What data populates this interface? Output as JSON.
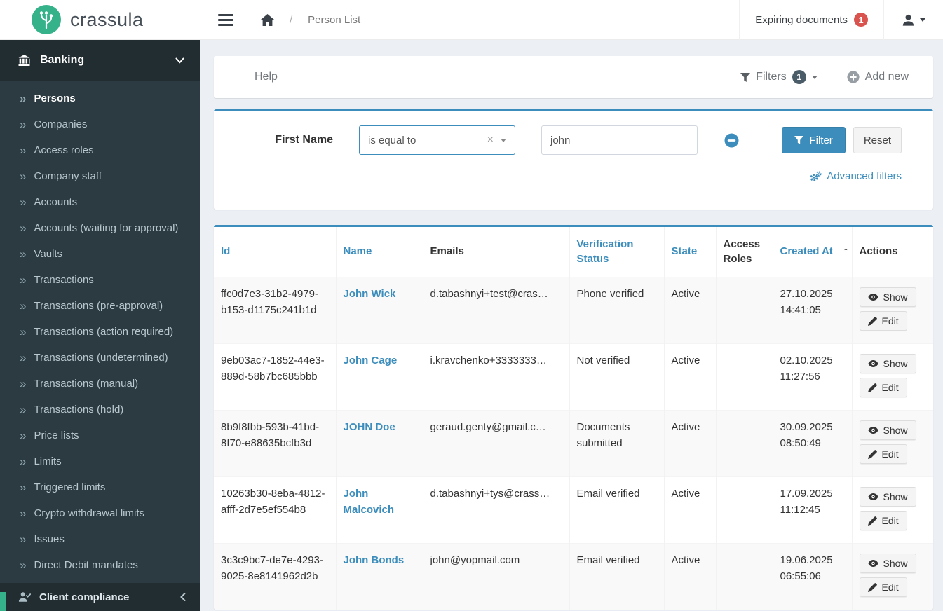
{
  "brand": {
    "name": "crassula"
  },
  "topbar": {
    "breadcrumb": "Person List",
    "expiring_documents_label": "Expiring documents",
    "expiring_documents_count": "1"
  },
  "sidebar": {
    "section_label": "Banking",
    "items": [
      {
        "label": "Persons",
        "active": true
      },
      {
        "label": "Companies"
      },
      {
        "label": "Access roles"
      },
      {
        "label": "Company staff"
      },
      {
        "label": "Accounts"
      },
      {
        "label": "Accounts (waiting for approval)"
      },
      {
        "label": "Vaults"
      },
      {
        "label": "Transactions"
      },
      {
        "label": "Transactions (pre-approval)"
      },
      {
        "label": "Transactions (action required)"
      },
      {
        "label": "Transactions (undetermined)"
      },
      {
        "label": "Transactions (manual)"
      },
      {
        "label": "Transactions (hold)"
      },
      {
        "label": "Price lists"
      },
      {
        "label": "Limits"
      },
      {
        "label": "Triggered limits"
      },
      {
        "label": "Crypto withdrawal limits"
      },
      {
        "label": "Issues"
      },
      {
        "label": "Direct Debit mandates"
      }
    ],
    "bottom_label": "Client compliance"
  },
  "toolbar": {
    "help_label": "Help",
    "filters_label": "Filters",
    "filters_count": "1",
    "add_new_label": "Add new"
  },
  "filter_panel": {
    "field_label": "First Name",
    "operator_value": "is equal to",
    "search_value": "john",
    "filter_button": "Filter",
    "reset_button": "Reset",
    "advanced_filters": "Advanced filters"
  },
  "table": {
    "columns": [
      {
        "label": "Id",
        "link": true
      },
      {
        "label": "Name",
        "link": true
      },
      {
        "label": "Emails",
        "link": false
      },
      {
        "label": "Verification Status",
        "link": true
      },
      {
        "label": "State",
        "link": true
      },
      {
        "label": "Access Roles",
        "link": false
      },
      {
        "label": "Created At",
        "link": true,
        "sorted": "asc"
      },
      {
        "label": "Actions",
        "link": false
      }
    ],
    "rows": [
      {
        "id": "ffc0d7e3-31b2-4979-b153-d1175c241b1d",
        "name": "John Wick",
        "email": "d.tabashnyi+test@cras…",
        "verification": "Phone verified",
        "state": "Active",
        "access_roles": "",
        "created_at": "27.10.2025 14:41:05"
      },
      {
        "id": "9eb03ac7-1852-44e3-889d-58b7bc685bbb",
        "name": "John Cage",
        "email": "i.kravchenko+3333333…",
        "verification": "Not verified",
        "state": "Active",
        "access_roles": "",
        "created_at": "02.10.2025 11:27:56"
      },
      {
        "id": "8b9f8fbb-593b-41bd-8f70-e88635bcfb3d",
        "name": "JOHN Doe",
        "email": "geraud.genty@gmail.c…",
        "verification": "Documents submitted",
        "state": "Active",
        "access_roles": "",
        "created_at": "30.09.2025 08:50:49"
      },
      {
        "id": "10263b30-8eba-4812-afff-2d7e5ef554b8",
        "name": "John Malcovich",
        "email": "d.tabashnyi+tys@crass…",
        "verification": "Email verified",
        "state": "Active",
        "access_roles": "",
        "created_at": "17.09.2025 11:12:45"
      },
      {
        "id": "3c3c9bc7-de7e-4293-9025-8e8141962d2b",
        "name": "John Bonds",
        "email": "john@yopmail.com",
        "verification": "Email verified",
        "state": "Active",
        "access_roles": "",
        "created_at": "19.06.2025 06:55:06"
      }
    ],
    "show_label": "Show",
    "edit_label": "Edit"
  },
  "icons": {
    "double_chevron": "»",
    "sort_asc": "↑",
    "clear_x": "×",
    "breadcrumb_separator": "/"
  },
  "colors": {
    "accent_blue": "#3c8dbc",
    "sidebar_bg": "#2c3b41",
    "sidebar_dark": "#222d32",
    "badge_red": "#d9534f",
    "logo_green": "#36b28a",
    "content_bg": "#ecf0f5"
  }
}
